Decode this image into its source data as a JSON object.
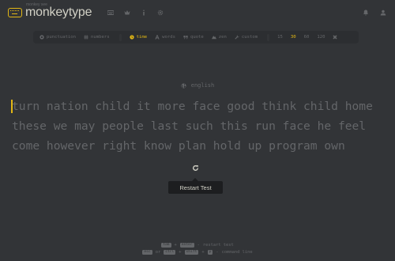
{
  "header": {
    "logo_sub": "monkey see",
    "logo_text": "monkeytype",
    "nav_icons": [
      "keyboard-icon",
      "crown-icon",
      "info-icon",
      "settings-icon"
    ],
    "right_icons": [
      "bell-icon",
      "user-icon"
    ]
  },
  "config": {
    "left_options": [
      {
        "icon": "at-icon",
        "label": "punctuation",
        "active": false
      },
      {
        "icon": "hash-icon",
        "label": "numbers",
        "active": false
      }
    ],
    "modes": [
      {
        "icon": "clock-icon",
        "label": "time",
        "active": true
      },
      {
        "icon": "a-icon",
        "label": "words",
        "active": false
      },
      {
        "icon": "quote-icon",
        "label": "quote",
        "active": false
      },
      {
        "icon": "mountain-icon",
        "label": "zen",
        "active": false
      },
      {
        "icon": "wrench-icon",
        "label": "custom",
        "active": false
      }
    ],
    "durations": [
      {
        "label": "15",
        "active": false
      },
      {
        "label": "30",
        "active": true
      },
      {
        "label": "60",
        "active": false
      },
      {
        "label": "120",
        "active": false
      }
    ]
  },
  "language": "english",
  "words": {
    "line1": "turn nation child it more face good think child home",
    "line2": "these we may people last such this run face he feel",
    "line3": "come however right know plan hold up program own"
  },
  "restart_tooltip": "Restart Test",
  "hints": {
    "row1": {
      "key1": "tab",
      "plus": "+",
      "key2": "enter",
      "dash": "-",
      "text": "restart test"
    },
    "row2": {
      "key1": "esc",
      "or": "or",
      "key2": "ctrl",
      "plus1": "+",
      "key3": "shift",
      "plus2": "+",
      "key4": "p",
      "dash": "-",
      "text": "command line"
    }
  },
  "colors": {
    "accent": "#e2b714",
    "bg": "#323437",
    "sub": "#646669",
    "text": "#d1d0c5"
  }
}
